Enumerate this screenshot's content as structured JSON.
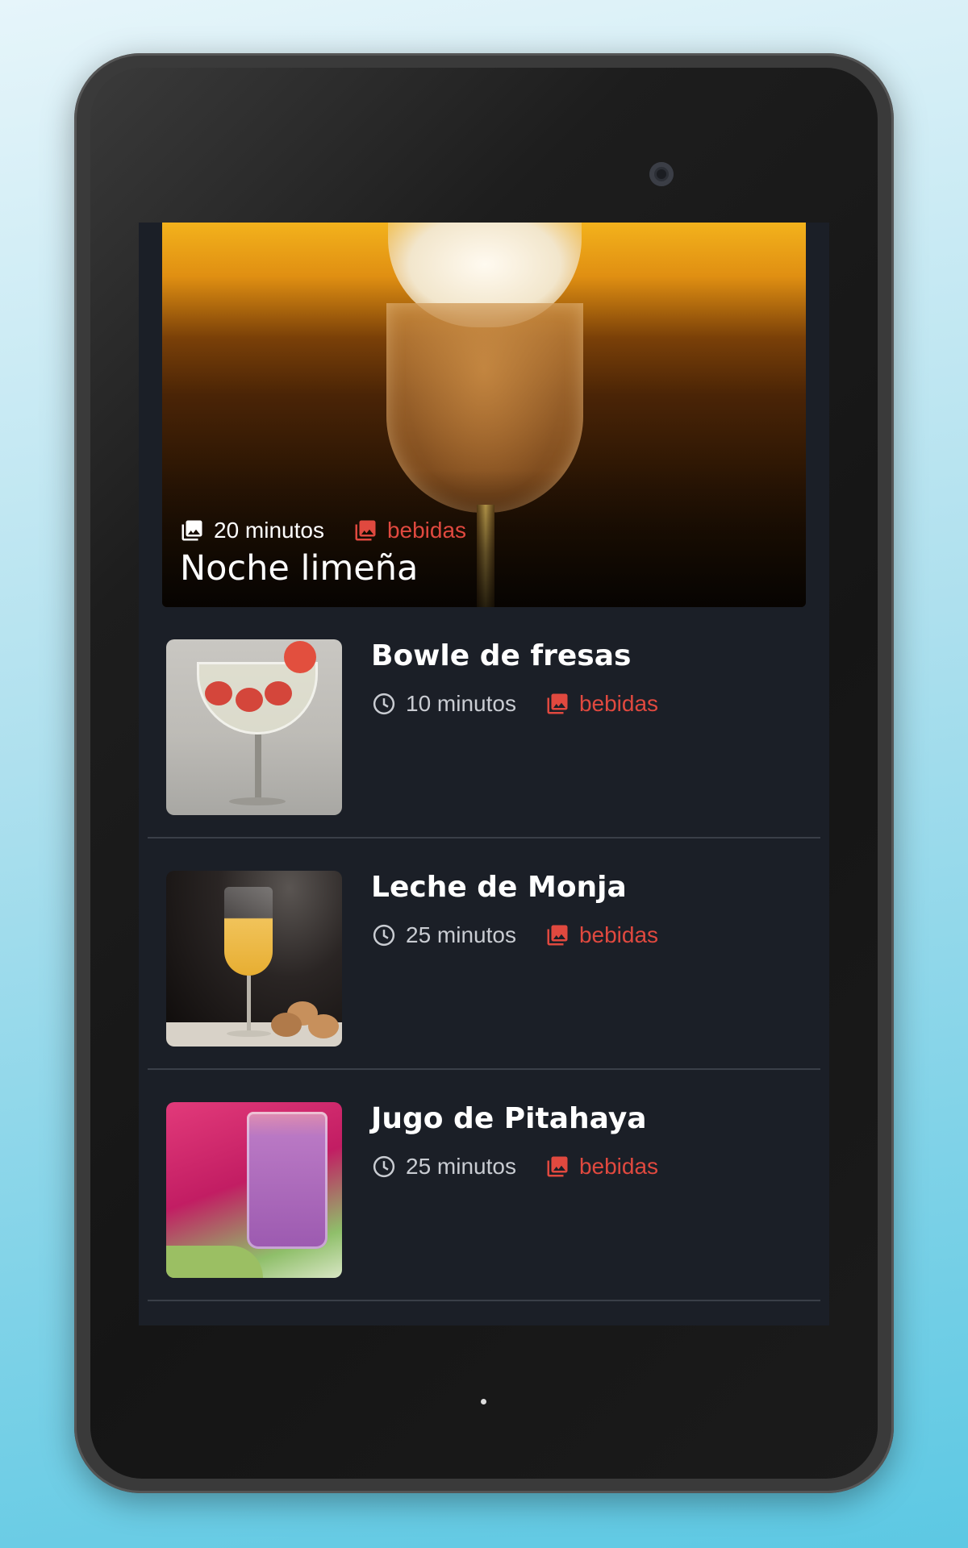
{
  "featured": {
    "time_icon": "photo-library-icon",
    "time": "20 minutos",
    "category_icon": "photo-library-icon",
    "category": "bebidas",
    "title": "Noche limeña"
  },
  "recipes": [
    {
      "title": "Bowle de fresas",
      "time_icon": "clock-icon",
      "time": "10 minutos",
      "category_icon": "photo-library-icon",
      "category": "bebidas"
    },
    {
      "title": "Leche de Monja",
      "time_icon": "clock-icon",
      "time": "25 minutos",
      "category_icon": "photo-library-icon",
      "category": "bebidas"
    },
    {
      "title": "Jugo de Pitahaya",
      "time_icon": "clock-icon",
      "time": "25 minutos",
      "category_icon": "photo-library-icon",
      "category": "bebidas"
    }
  ],
  "colors": {
    "background": "#1b1f27",
    "accent": "#e0493f",
    "divider": "#3a3f48"
  }
}
